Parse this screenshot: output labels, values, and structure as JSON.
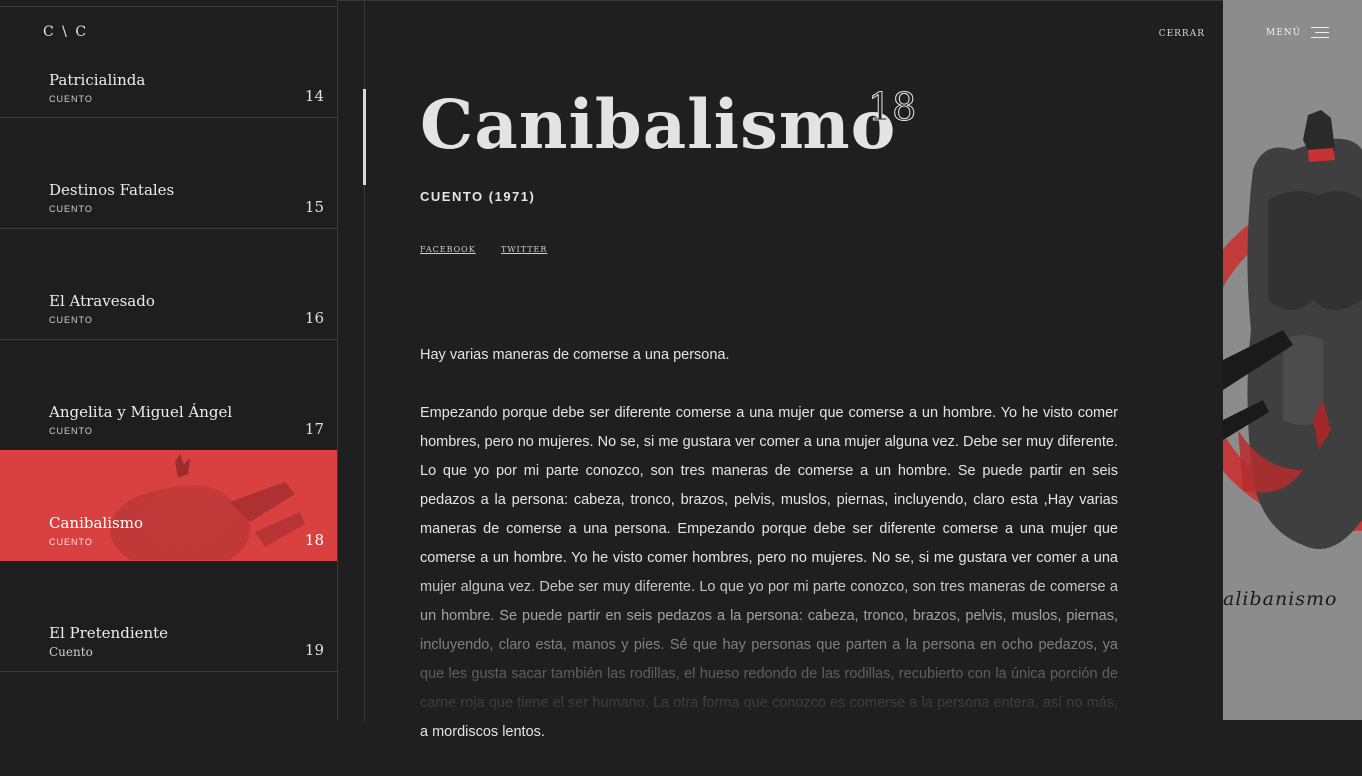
{
  "logo": {
    "text": "C \\ C"
  },
  "sidebar": {
    "stories": [
      {
        "title": "Patricialinda",
        "kind": "CUENTO",
        "number": "14"
      },
      {
        "title": "Destinos Fatales",
        "kind": "CUENTO",
        "number": "15"
      },
      {
        "title": "El Atravesado",
        "kind": "CUENTO",
        "number": "16"
      },
      {
        "title": "Angelita y Miguel Ángel",
        "kind": "CUENTO",
        "number": "17"
      },
      {
        "title": "Canibalismo",
        "kind": "CUENTO",
        "number": "18",
        "active": true
      },
      {
        "title": "El Pretendiente",
        "kind": "Cuento",
        "number": "19"
      }
    ]
  },
  "header": {
    "close_label": "CERRAR",
    "menu_label": "MENÚ"
  },
  "story": {
    "title": "Canibalismo",
    "number": "18",
    "subtitle": "CUENTO (1971)",
    "share": {
      "facebook": "FACEBOOK",
      "twitter": "TWITTER"
    },
    "paragraphs": [
      "Hay varias maneras de comerse a una persona.",
      "Empezando porque debe ser diferente comerse a una mujer que comerse a un hombre. Yo he visto comer hombres, pero no mujeres. No se, si me gustara ver comer a una mujer alguna vez. Debe ser muy diferente. Lo que yo por mi parte conozco, son tres maneras de comerse a un hombre. Se puede partir en seis pedazos a la persona: cabeza, tronco, brazos, pelvis, muslos, piernas, incluyendo, claro esta ,Hay varias maneras de comerse a una persona. Empezando porque debe ser diferente comerse a una mujer que comerse a un hombre. Yo he visto comer hombres, pero no mujeres. No se, si me gustara ver comer a una mujer alguna vez. Debe ser muy diferente. Lo que yo por mi parte conozco, son tres maneras de comerse a un hombre. Se puede partir en seis pedazos a la persona: cabeza, tronco, brazos, pelvis, muslos, piernas, incluyendo, claro esta, manos y pies. Sé que hay personas que parten a la persona en ocho pedazos, ya que les gusta sacar también las rodillas, el hueso redondo de las rodillas, recubierto con la única porción de carne roja que tiene el ser humano. La otra forma que conozco es comerse a la persona entera, así no más, a mordiscos lentos."
    ]
  },
  "art_panel": {
    "caption": "alibanismo"
  },
  "colors": {
    "background": "#1f1f1f",
    "accent_red": "#d94040",
    "text": "#e4e4e4",
    "divider": "#3a3a3a"
  }
}
